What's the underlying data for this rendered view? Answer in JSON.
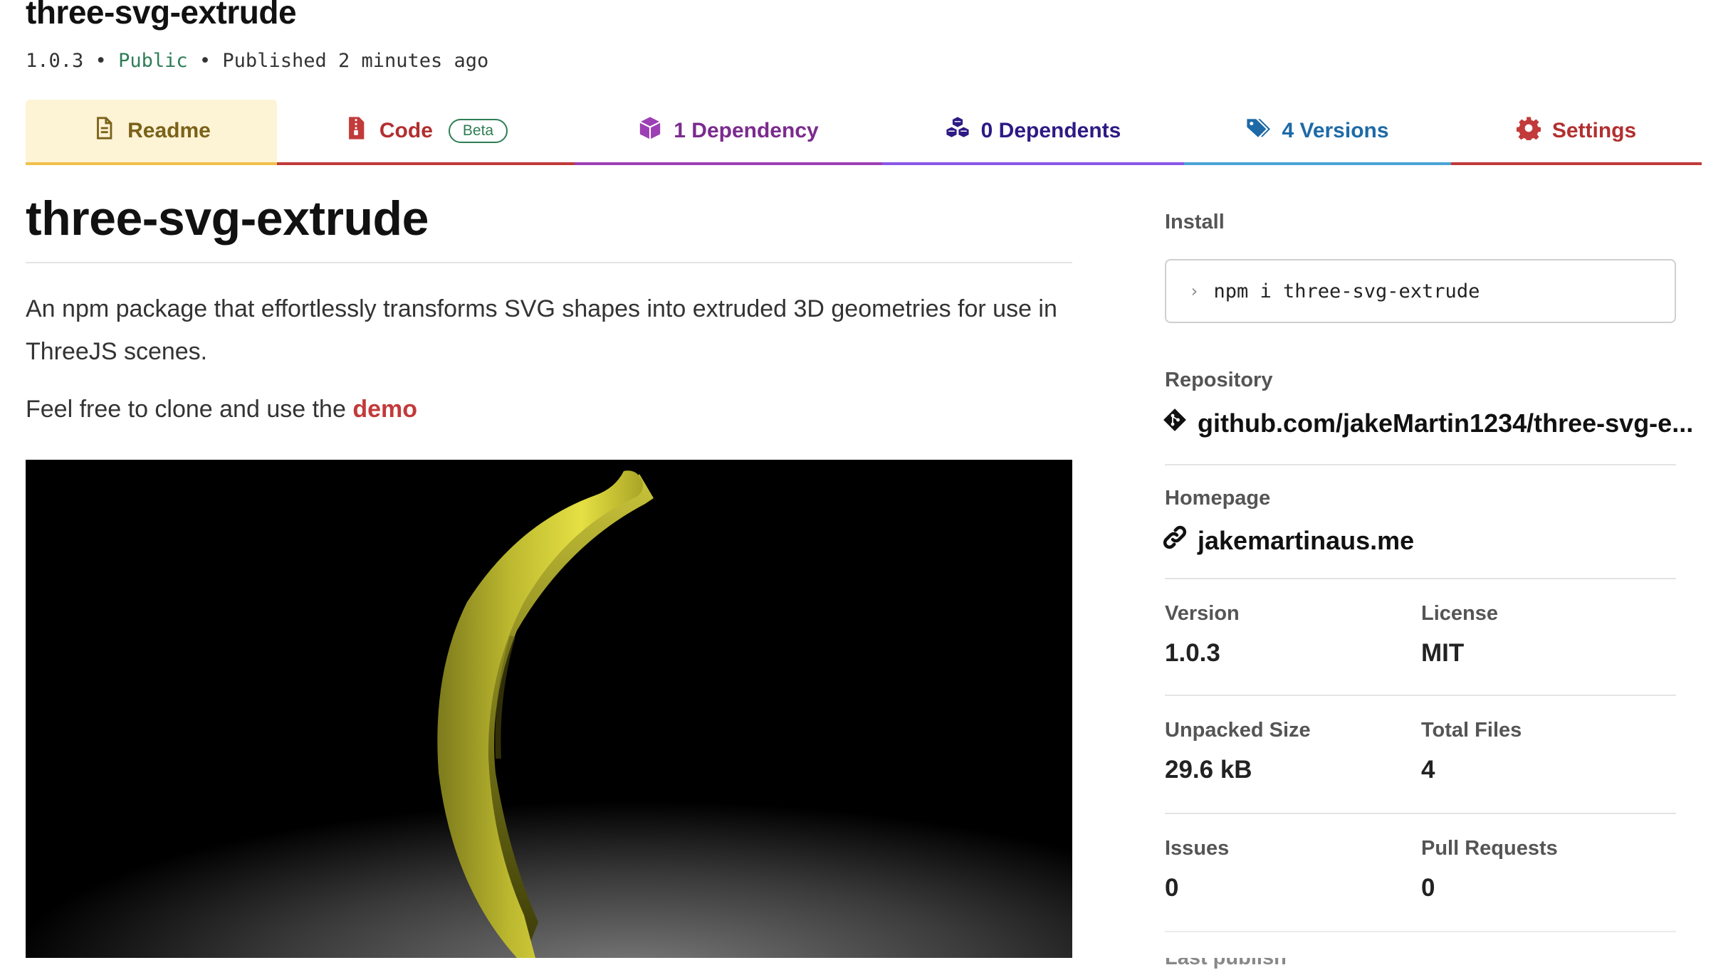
{
  "header": {
    "package_name": "three-svg-extrude",
    "version": "1.0.3",
    "separator": "•",
    "visibility": "Public",
    "published": "Published 2 minutes ago"
  },
  "tabs": [
    {
      "label": "Readme",
      "icon": "file-text-icon",
      "active": true,
      "color": "#7a6219"
    },
    {
      "label": "Code",
      "icon": "zip-file-icon",
      "badge": "Beta",
      "color": "#b22f2f"
    },
    {
      "label": "1 Dependency",
      "icon": "box-icon",
      "color": "#7b2a8e"
    },
    {
      "label": "0 Dependents",
      "icon": "boxes-icon",
      "color": "#2d1a84"
    },
    {
      "label": "4 Versions",
      "icon": "tags-icon",
      "color": "#1e6aa6"
    },
    {
      "label": "Settings",
      "icon": "gear-icon",
      "color": "#b22f2f"
    }
  ],
  "readme": {
    "heading": "three-svg-extrude",
    "description": "An npm package that effortlessly transforms SVG shapes into extruded 3D geometries for use in ThreeJS scenes.",
    "demo_prefix": "Feel free to clone and use the",
    "demo_link": "demo",
    "image_description_icon": "banana-render"
  },
  "sidebar": {
    "install": {
      "label": "Install",
      "prompt": "›",
      "command": "npm i three-svg-extrude"
    },
    "repository": {
      "label": "Repository",
      "icon": "git-icon",
      "value": "github.com/jakeMartin1234/three-svg-e..."
    },
    "homepage": {
      "label": "Homepage",
      "icon": "link-icon",
      "value": "jakemartinaus.me"
    },
    "version": {
      "label": "Version",
      "value": "1.0.3"
    },
    "license": {
      "label": "License",
      "value": "MIT"
    },
    "unpacked_size": {
      "label": "Unpacked Size",
      "value": "29.6 kB"
    },
    "total_files": {
      "label": "Total Files",
      "value": "4"
    },
    "issues": {
      "label": "Issues",
      "value": "0"
    },
    "pull_requests": {
      "label": "Pull Requests",
      "value": "0"
    },
    "last_publish_label": "Last publish"
  },
  "colors": {
    "accent_red": "#c23a3a",
    "public_green": "#2e7d55",
    "readme_tab_bg": "#fdf3d5"
  }
}
